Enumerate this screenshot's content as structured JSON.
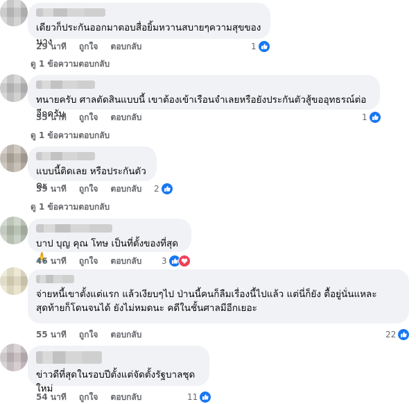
{
  "labels": {
    "like": "ถูกใจ",
    "reply": "ตอบกลับ"
  },
  "comments": [
    {
      "text": "เดียวก็ประกันออกมาตอบสื่อยิ้มหวานสบายๆความสุขของนาง",
      "time": "29 นาที",
      "count": "1",
      "replies": "ดู 1 ข้อความตอบกลับ"
    },
    {
      "text": "ทนายครับ ศาลตัดสินแบบนี้ เขาต้องเข้าเรือนจำเลยหรือยังประกันตัวสู้ขออุทธรณ์ต่ออีกครับ",
      "time": "35 นาที",
      "count": "1",
      "replies": "ดู 1 ข้อความตอบกลับ"
    },
    {
      "text": "แบบนี้ติดเลย หรือประกันตัวคะ",
      "time": "39 นาที",
      "count": "2",
      "replies": "ดู 1 ข้อความตอบกลับ"
    },
    {
      "text": "บาป บุญ คุณ โทษ เป็นที่ตั้งของที่สุด🙏",
      "time": "46 นาที",
      "count": "3",
      "replies": ""
    },
    {
      "text": "จ่ายหนี้เขาตั้งแต่แรก แล้วเงียบๆไป ป่านนี้คนก็ลืมเรื่องนี้ไปแล้ว แต่นี่ก็ยัง ตื้อยู่นั่นแหละ สุดท้ายก็โดนจนได้ ยังไม่หมดนะ คดีในชั้นศาลมีอีกเยอะ",
      "time": "55 นาที",
      "count": "22",
      "replies": ""
    },
    {
      "text": "ข่าวดีที่สุดในรอบปีตั้งแต่จัดตั้งรัฐบาลชุดใหม่",
      "time": "54 นาที",
      "count": "11",
      "replies": ""
    }
  ],
  "colors": {
    "bubble": "#f0f2f5",
    "like": "#1877f2",
    "love": "#f33e58",
    "meta": "#65676b"
  },
  "icons": {
    "like": "like-icon",
    "love": "love-icon"
  }
}
